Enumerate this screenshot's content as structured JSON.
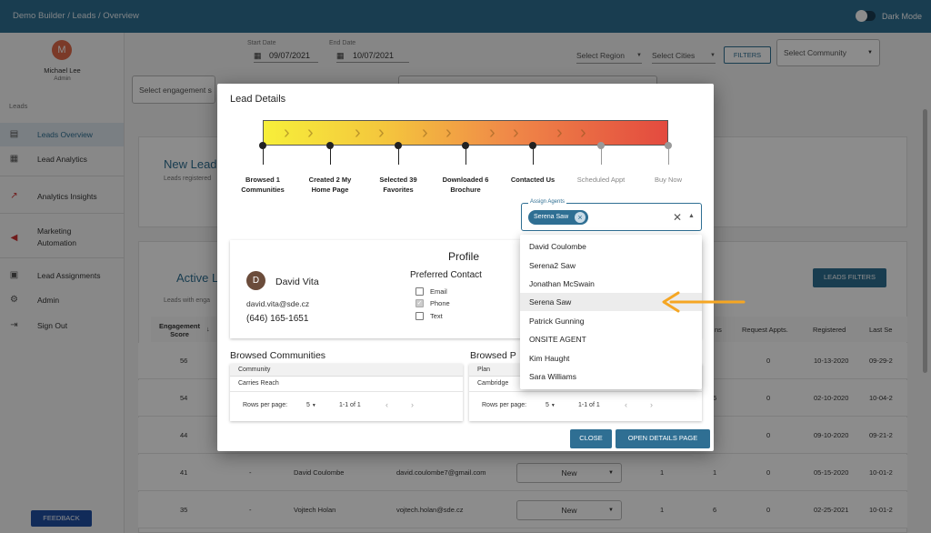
{
  "topbar": {
    "breadcrumb": "Demo Builder  /  Leads / Overview",
    "dark_mode_label": "Dark Mode"
  },
  "sidebar": {
    "user_initial": "M",
    "user_name": "Michael Lee",
    "user_role": "Admin",
    "section_label": "Leads",
    "items": [
      {
        "label": "Leads Overview",
        "icon": "document-icon"
      },
      {
        "label": "Lead Analytics",
        "icon": "chart-icon"
      },
      {
        "label": "Analytics Insights",
        "icon": "trend-icon"
      },
      {
        "label": "Marketing Automation",
        "icon": "megaphone-icon"
      },
      {
        "label": "Lead Assignments",
        "icon": "badge-icon"
      },
      {
        "label": "Admin",
        "icon": "gear-icon"
      },
      {
        "label": "Sign Out",
        "icon": "sign-out-icon"
      }
    ],
    "marketing_line1": "Marketing",
    "marketing_line2": "Automation",
    "feedback_label": "FEEDBACK"
  },
  "filters": {
    "start_date_label": "Start Date",
    "start_date": "09/07/2021",
    "end_date_label": "End Date",
    "end_date": "10/07/2021",
    "region_placeholder": "Select Region",
    "cities_placeholder": "Select Cities",
    "filters_button": "FILTERS",
    "community_placeholder": "Select Community",
    "engagement_placeholder": "Select engagement s"
  },
  "background": {
    "new_leads_title": "New Lead",
    "new_leads_sub": "Leads registered",
    "active_leads_title": "Active L",
    "active_leads_sub": "Leads with enga",
    "leads_filters_button": "LEADS FILTERS",
    "columns": {
      "engagement_1": "Engagement",
      "engagement_2": "Score",
      "ns": "ns",
      "request": "Request Appts.",
      "registered": "Registered",
      "last": "Last Se"
    },
    "rows": [
      {
        "score": "56",
        "req": "0",
        "registered": "10-13-2020",
        "last": "09-29-2"
      },
      {
        "score": "54",
        "mid": "6",
        "req": "0",
        "registered": "02-10-2020",
        "last": "10-04-2"
      },
      {
        "score": "44",
        "req": "0",
        "registered": "09-10-2020",
        "last": "09-21-2"
      },
      {
        "score": "41",
        "dash": "-",
        "name": "David Coulombe",
        "email": "david.coulombe7@gmail.com",
        "status": "New",
        "a": "1",
        "b": "1",
        "req": "0",
        "registered": "05-15-2020",
        "last": "10-01-2"
      },
      {
        "score": "35",
        "dash": "-",
        "name": "Vojtech Holan",
        "email": "vojtech.holan@sde.cz",
        "status": "New",
        "a": "1",
        "b": "6",
        "req": "0",
        "registered": "02-25-2021",
        "last": "10-01-2"
      }
    ]
  },
  "modal": {
    "title": "Lead Details",
    "steps": [
      {
        "line1": "Browsed 1",
        "line2": "Communities",
        "done": true
      },
      {
        "line1": "Created 2 My",
        "line2": "Home Page",
        "done": true
      },
      {
        "line1": "Selected 39",
        "line2": "Favorites",
        "done": true
      },
      {
        "line1": "Downloaded 6",
        "line2": "Brochure",
        "done": true
      },
      {
        "line1": "Contacted Us",
        "line2": "",
        "done": true
      },
      {
        "line1": "Scheduled Appt",
        "line2": "",
        "done": false
      },
      {
        "line1": "Buy Now",
        "line2": "",
        "done": false
      }
    ],
    "assign_agents_label": "Assign Agents",
    "assigned_chip": "Serena Saw",
    "profile": {
      "title": "Profile",
      "initial": "D",
      "name": "David Vita",
      "email": "david.vita@sde.cz",
      "phone": "(646) 165-1651",
      "preferred_contact_title": "Preferred Contact",
      "contact_options": [
        {
          "label": "Email",
          "checked": false
        },
        {
          "label": "Phone",
          "checked": true
        },
        {
          "label": "Text",
          "checked": false
        }
      ]
    },
    "browsed_communities": {
      "title": "Browsed Communities",
      "column": "Community",
      "rows": [
        "Carries Reach"
      ],
      "rows_per_page_label": "Rows per page:",
      "rows_per_page": "5",
      "range": "1-1 of 1"
    },
    "browsed_plans": {
      "title": "Browsed P",
      "column": "Plan",
      "rows": [
        "Cambridge"
      ],
      "rows_per_page_label": "Rows per page:",
      "rows_per_page": "5",
      "range": "1-1 of 1"
    },
    "close_button": "CLOSE",
    "open_details_button": "OPEN DETAILS PAGE"
  },
  "agent_dropdown": {
    "options": [
      "David Coulombe",
      "Serena2 Saw",
      "Jonathan McSwain",
      "Serena Saw",
      "Patrick Gunning",
      "ONSITE AGENT",
      "Kim Haught",
      "Sara Williams"
    ],
    "highlighted": "Serena Saw"
  },
  "colors": {
    "primary": "#2f6f93",
    "arrow": "#f5a623",
    "avatar": "#e06a4a",
    "feedback": "#1f4fa3"
  }
}
